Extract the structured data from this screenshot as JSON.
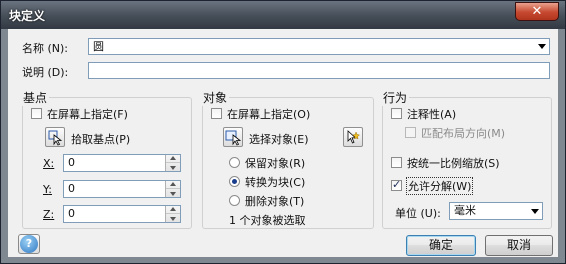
{
  "window": {
    "title": "块定义",
    "close_glyph": "✕"
  },
  "name_field": {
    "label": "名称",
    "accel": "(N):",
    "value": "圆"
  },
  "desc_field": {
    "label": "说明",
    "accel": "(D):",
    "value": ""
  },
  "base_point": {
    "title": "基点",
    "specify_on_screen": {
      "label": "在屏幕上指定",
      "accel": "(F)",
      "checked": false
    },
    "pick_button": {
      "label": "拾取基点",
      "accel": "(P)"
    },
    "x": {
      "label": "X",
      "suffix": ":",
      "value": "0"
    },
    "y": {
      "label": "Y",
      "suffix": ":",
      "value": "0"
    },
    "z": {
      "label": "Z",
      "suffix": ":",
      "value": "0"
    }
  },
  "objects": {
    "title": "对象",
    "specify_on_screen": {
      "label": "在屏幕上指定",
      "accel": "(O)",
      "checked": false
    },
    "select_button": {
      "label": "选择对象",
      "accel": "(E)"
    },
    "options": [
      {
        "label": "保留对象",
        "accel": "(R)",
        "checked": false
      },
      {
        "label": "转换为块",
        "accel": "(C)",
        "checked": true
      },
      {
        "label": "删除对象",
        "accel": "(T)",
        "checked": false
      }
    ],
    "status": "1 个对象被选取"
  },
  "behavior": {
    "title": "行为",
    "annotative": {
      "label": "注释性",
      "accel": "(A)",
      "checked": false
    },
    "match_orientation": {
      "label": "匹配布局方向",
      "accel": "(M)",
      "checked": false,
      "disabled": true
    },
    "scale_uniformly": {
      "label": "按统一比例缩放",
      "accel": "(S)",
      "checked": false
    },
    "allow_exploding": {
      "label": "允许分解",
      "accel": "(W)",
      "checked": true
    },
    "unit": {
      "label": "单位",
      "accel": "(U):",
      "value": "毫米"
    }
  },
  "footer": {
    "help_glyph": "?",
    "ok_label": "确定",
    "cancel_label": "取消"
  }
}
